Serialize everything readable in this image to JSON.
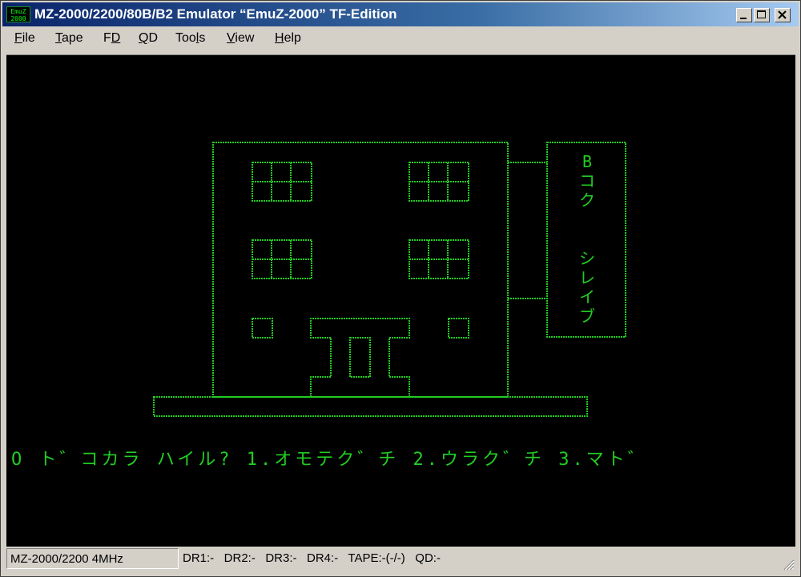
{
  "window": {
    "title": "MZ-2000/2200/80B/B2 Emulator “EmuZ-2000” TF-Edition",
    "icon_text_line1": "EmuZ",
    "icon_text_line2": "2000"
  },
  "menu": [
    {
      "label": "File",
      "mnemonic": "F",
      "rest": "ile"
    },
    {
      "label": "Tape",
      "mnemonic": "T",
      "rest": "ape"
    },
    {
      "label": "FD",
      "mnemonic": "D",
      "prefix": "F"
    },
    {
      "label": "QD",
      "mnemonic": "Q",
      "rest": "D"
    },
    {
      "label": "Tools",
      "mnemonic": "l",
      "prefix": "Too",
      "rest": "s"
    },
    {
      "label": "View",
      "mnemonic": "V",
      "rest": "iew"
    },
    {
      "label": "Help",
      "mnemonic": "H",
      "rest": "elp"
    }
  ],
  "screen": {
    "sign_text": [
      "B",
      "コ",
      "ク",
      "",
      "シ",
      "レ",
      "イ",
      "ブ"
    ],
    "prompt": "O ト゛コカラ ハイル? 1.オモテク゛チ 2.ウラク゛チ 3.マト゛",
    "text_color": "#22cc22"
  },
  "status": {
    "machine": "MZ-2000/2200 4MHz",
    "drives": "DR1:-   DR2:-   DR3:-   DR4:-   TAPE:-(-/-)   QD:-"
  }
}
